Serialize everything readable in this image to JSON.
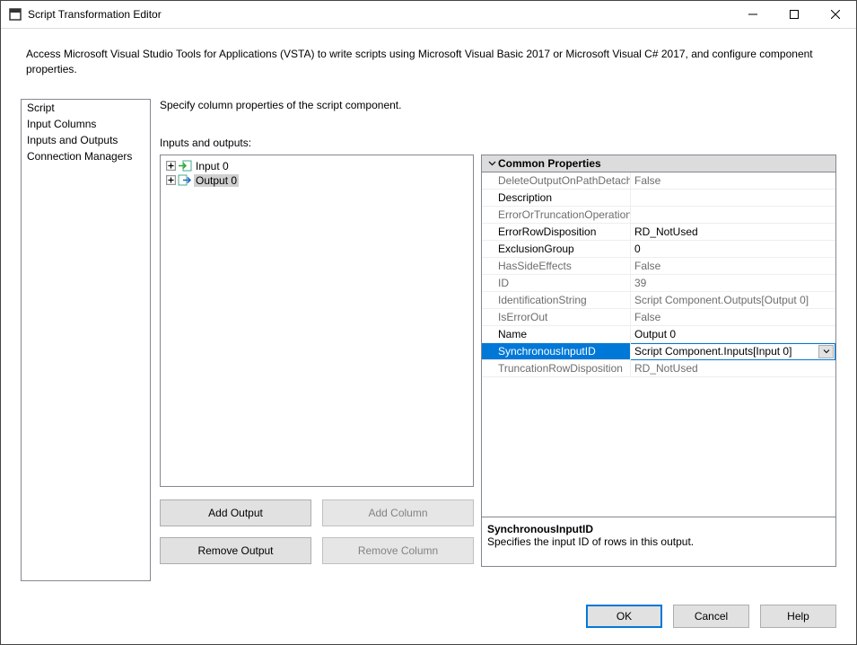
{
  "window": {
    "title": "Script Transformation Editor"
  },
  "intro": "Access Microsoft Visual Studio Tools for Applications (VSTA) to write scripts using Microsoft Visual Basic 2017 or Microsoft Visual C# 2017, and configure component properties.",
  "nav": {
    "items": [
      "Script",
      "Input Columns",
      "Inputs and Outputs",
      "Connection Managers"
    ]
  },
  "section": {
    "desc": "Specify column properties of the script component.",
    "io_label": "Inputs and outputs:"
  },
  "tree": {
    "items": [
      {
        "label": "Input 0",
        "selected": false
      },
      {
        "label": "Output 0",
        "selected": true
      }
    ]
  },
  "props": {
    "header": "Common Properties",
    "rows": [
      {
        "name": "DeleteOutputOnPathDetached",
        "value": "False",
        "gray": true
      },
      {
        "name": "Description",
        "value": "",
        "gray": false
      },
      {
        "name": "ErrorOrTruncationOperation",
        "value": "",
        "gray": true
      },
      {
        "name": "ErrorRowDisposition",
        "value": "RD_NotUsed",
        "gray": false
      },
      {
        "name": "ExclusionGroup",
        "value": "0",
        "gray": false
      },
      {
        "name": "HasSideEffects",
        "value": "False",
        "gray": true
      },
      {
        "name": "ID",
        "value": "39",
        "gray": true
      },
      {
        "name": "IdentificationString",
        "value": "Script Component.Outputs[Output 0]",
        "gray": true
      },
      {
        "name": "IsErrorOut",
        "value": "False",
        "gray": true
      },
      {
        "name": "Name",
        "value": "Output 0",
        "gray": false
      },
      {
        "name": "SynchronousInputID",
        "value": "Script Component.Inputs[Input 0]",
        "gray": false,
        "selected": true,
        "dropdown": true
      },
      {
        "name": "TruncationRowDisposition",
        "value": "RD_NotUsed",
        "gray": true
      }
    ],
    "help_title": "SynchronousInputID",
    "help_text": "Specifies the input ID of rows in this output."
  },
  "buttons": {
    "add_output": "Add Output",
    "add_column": "Add Column",
    "remove_output": "Remove Output",
    "remove_column": "Remove Column"
  },
  "footer": {
    "ok": "OK",
    "cancel": "Cancel",
    "help": "Help"
  }
}
